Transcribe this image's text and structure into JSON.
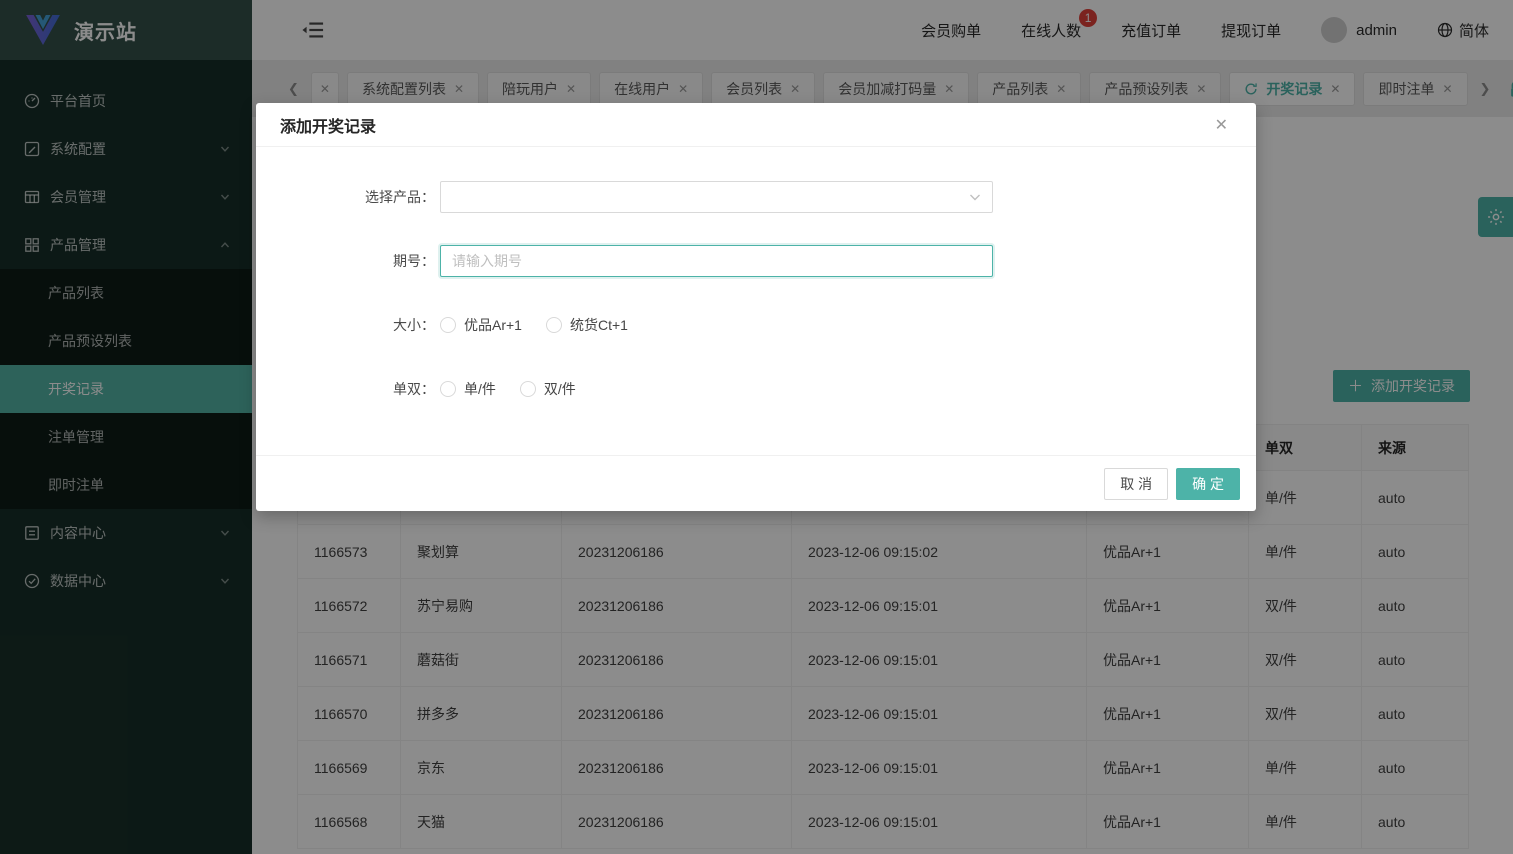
{
  "brand": {
    "name": "演示站"
  },
  "sidebar": {
    "items": [
      {
        "label": "平台首页",
        "icon": "dashboard-icon",
        "type": "item"
      },
      {
        "label": "系统配置",
        "icon": "edit-icon",
        "type": "group",
        "state": "collapsed"
      },
      {
        "label": "会员管理",
        "icon": "table-icon",
        "type": "group",
        "state": "collapsed"
      },
      {
        "label": "产品管理",
        "icon": "appstore-icon",
        "type": "group",
        "state": "expanded",
        "children": [
          {
            "label": "产品列表"
          },
          {
            "label": "产品预设列表"
          },
          {
            "label": "开奖记录",
            "active": true
          },
          {
            "label": "注单管理"
          },
          {
            "label": "即时注单"
          }
        ]
      },
      {
        "label": "内容中心",
        "icon": "container-icon",
        "type": "group",
        "state": "collapsed"
      },
      {
        "label": "数据中心",
        "icon": "check-circle-icon",
        "type": "group",
        "state": "collapsed"
      }
    ]
  },
  "header": {
    "links": [
      "会员购单",
      "在线人数",
      "充值订单",
      "提现订单"
    ],
    "online_badge": "1",
    "user": "admin",
    "language": "简体"
  },
  "tabs": {
    "items": [
      {
        "label": "系统配置列表"
      },
      {
        "label": "陪玩用户"
      },
      {
        "label": "在线用户"
      },
      {
        "label": "会员列表"
      },
      {
        "label": "会员加减打码量"
      },
      {
        "label": "产品列表"
      },
      {
        "label": "产品预设列表"
      },
      {
        "label": "开奖记录",
        "active": true
      },
      {
        "label": "即时注单"
      }
    ]
  },
  "toolbar": {
    "add_button": "添加开奖记录"
  },
  "table": {
    "headers": [
      "",
      "",
      "",
      "",
      "",
      "单双",
      "来源"
    ],
    "rows": [
      [
        "",
        "",
        "",
        "",
        "",
        "单/件",
        "auto"
      ],
      [
        "1166573",
        "聚划算",
        "20231206186",
        "2023-12-06 09:15:02",
        "优品Ar+1",
        "单/件",
        "auto"
      ],
      [
        "1166572",
        "苏宁易购",
        "20231206186",
        "2023-12-06 09:15:01",
        "优品Ar+1",
        "双/件",
        "auto"
      ],
      [
        "1166571",
        "蘑菇街",
        "20231206186",
        "2023-12-06 09:15:01",
        "优品Ar+1",
        "双/件",
        "auto"
      ],
      [
        "1166570",
        "拼多多",
        "20231206186",
        "2023-12-06 09:15:01",
        "优品Ar+1",
        "双/件",
        "auto"
      ],
      [
        "1166569",
        "京东",
        "20231206186",
        "2023-12-06 09:15:01",
        "优品Ar+1",
        "单/件",
        "auto"
      ],
      [
        "1166568",
        "天猫",
        "20231206186",
        "2023-12-06 09:15:01",
        "优品Ar+1",
        "单/件",
        "auto"
      ]
    ]
  },
  "modal": {
    "title": "添加开奖记录",
    "fields": {
      "product_label": "选择产品：",
      "issue_label": "期号：",
      "issue_placeholder": "请输入期号",
      "size_label": "大小：",
      "size_options": [
        "优品Ar+1",
        "统货Ct+1"
      ],
      "parity_label": "单双：",
      "parity_options": [
        "单/件",
        "双/件"
      ]
    },
    "cancel_label": "取 消",
    "ok_label": "确 定"
  },
  "colors": {
    "primary": "#4db3a8",
    "badge": "#e0403a",
    "sidebar": "#172f28"
  }
}
